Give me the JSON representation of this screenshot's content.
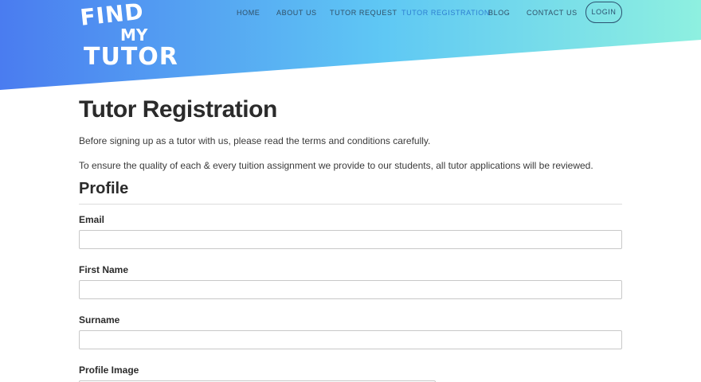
{
  "header": {
    "logo": {
      "line1": "FIND",
      "line2": "MY",
      "line3": "TUTOR"
    },
    "nav": [
      {
        "label": "HOME",
        "active": false
      },
      {
        "label": "ABOUT US",
        "active": false
      },
      {
        "label": "TUTOR REQUEST",
        "active": false
      },
      {
        "label": "TUTOR REGISTRATION",
        "active": true
      },
      {
        "label": "BLOG",
        "active": false
      },
      {
        "label": "CONTACT US",
        "active": false
      }
    ],
    "login_label": "LOGIN",
    "colors": {
      "gradient_start": "#4a7cf0",
      "gradient_mid": "#5fc8f4",
      "gradient_end": "#8ef0e0",
      "nav_text": "#2f4f66",
      "nav_active": "#2d7fd1"
    }
  },
  "main": {
    "title": "Tutor Registration",
    "intro": [
      "Before signing up as a tutor with us, please read the terms and conditions carefully.",
      "To ensure the quality of each & every tuition assignment we provide to our students, all tutor applications will be reviewed."
    ],
    "section_title": "Profile",
    "fields": [
      {
        "label": "Email",
        "value": ""
      },
      {
        "label": "First Name",
        "value": ""
      },
      {
        "label": "Surname",
        "value": ""
      },
      {
        "label": "Profile Image"
      }
    ]
  }
}
